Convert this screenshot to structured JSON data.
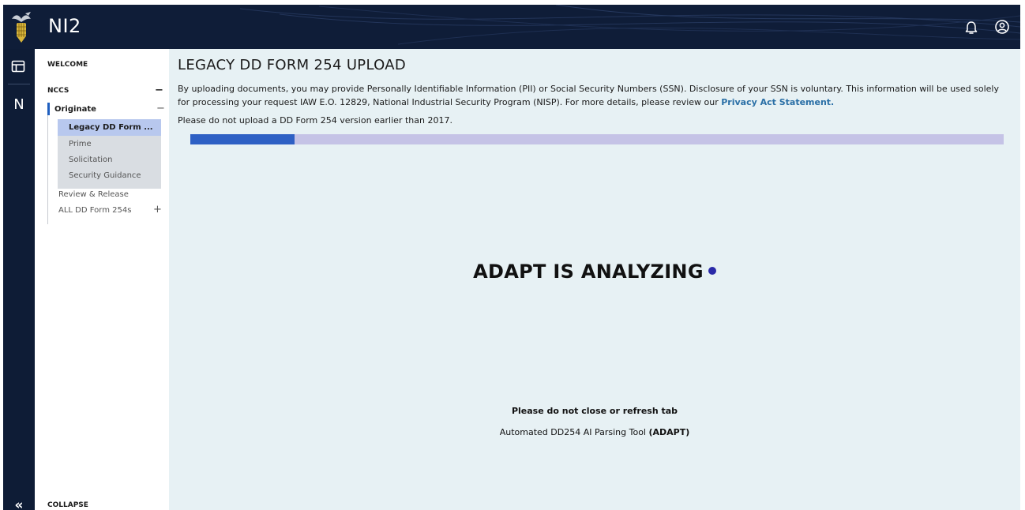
{
  "app": {
    "title": "NI2"
  },
  "rail": {
    "n_label": "N",
    "collapse_glyph": "«"
  },
  "sidebar": {
    "welcome": "WELCOME",
    "section": "NCCS",
    "section_toggle": "−",
    "group": "Originate",
    "group_toggle": "−",
    "items": [
      {
        "label": "Legacy DD Form ...",
        "active": true
      },
      {
        "label": "Prime"
      },
      {
        "label": "Solicitation"
      },
      {
        "label": "Security Guidance"
      }
    ],
    "review": "Review & Release",
    "all_forms": "ALL DD Form 254s",
    "all_forms_toggle": "+",
    "collapse": "COLLAPSE"
  },
  "main": {
    "title": "LEGACY DD FORM 254 UPLOAD",
    "disclaimer": "By uploading documents, you may provide Personally Identifiable Information (PII) or Social Security Numbers (SSN). Disclosure of your SSN is voluntary. This information will be used solely for processing your request IAW E.O. 12829, National Industrial Security Program (NISP). For more details, please review our",
    "privacy_link": "Privacy Act Statement.",
    "notice": "Please do not upload a DD Form 254 version earlier than 2017.",
    "progress_fraction": 0.128,
    "status": "ADAPT IS ANALYZING",
    "warning": "Please do not close or refresh tab",
    "tool_prefix": "Automated DD254 AI Parsing Tool",
    "tool_acronym": "(ADAPT)"
  },
  "colors": {
    "header_bg": "#0f1d38",
    "main_bg": "#e7f1f4",
    "progress_fill": "#2e60c4",
    "progress_track": "#c5c3e6",
    "link": "#2a6fa6",
    "active_item_bg": "#b8c8ee"
  },
  "icons": {
    "logo": "eagle-seal-icon",
    "notifications": "bell-icon",
    "account": "user-circle-icon",
    "rail_dashboard": "dashboard-icon",
    "rail_collapse": "double-chevron-left-icon"
  }
}
